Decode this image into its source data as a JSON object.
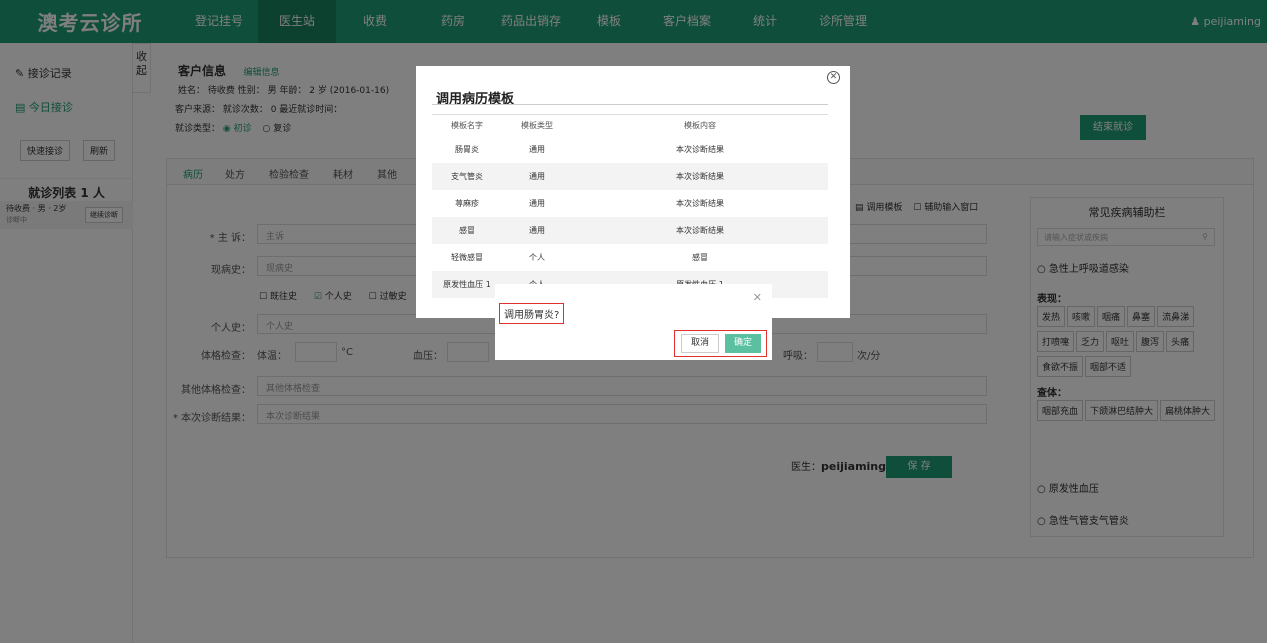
{
  "app": {
    "logo": "澳考云诊所",
    "user": "peijiaming"
  },
  "nav": [
    "登记挂号",
    "医生站",
    "收费",
    "药房",
    "药品出销存",
    "模板",
    "客户档案",
    "统计",
    "诊所管理"
  ],
  "sidebar": {
    "links": [
      "接诊记录",
      "今日接诊"
    ],
    "buttons": [
      "快速接诊",
      "刷新"
    ],
    "queue_title": "就诊列表 1 人",
    "patient": {
      "name": "待收费 · 男 · 2岁",
      "status": "诊断中",
      "action": "继续诊断"
    },
    "collapse": "收起"
  },
  "customer": {
    "header": "客户信息",
    "edit": "编辑信息",
    "line1": "姓名：  待收费     性别：  男     年龄：  2 岁 (2016-01-16)",
    "line2": "客户来源：     就诊次数：  0     最近就诊时间：",
    "line3_label": "就诊类型：",
    "visit_types": [
      "初诊",
      "复诊"
    ],
    "end_button": "结束就诊"
  },
  "tabs": [
    "病历",
    "处方",
    "检验检查",
    "耗材",
    "其他"
  ],
  "form": {
    "toolbar": [
      "调用模板",
      "辅助输入窗口"
    ],
    "chief_label": "* 主 诉：",
    "chief_value": "主诉",
    "present_label": "现病史：",
    "present_value": "现病史",
    "history_opts": [
      "既往史",
      "个人史",
      "过敏史"
    ],
    "personal_label": "个人史：",
    "personal_value": "个人史",
    "vitals_label": "体格检查：",
    "temp_label": "体温：",
    "temp_unit": "°C",
    "bp_label": "血压：",
    "resp_label": "呼吸：",
    "resp_unit": "次/分",
    "other_label": "其他体格检查：",
    "other_value": "其他体格检查",
    "diag_label": "* 本次诊断结果：",
    "diag_value": "本次诊断结果",
    "doctor_label": "医生：",
    "doctor": "peijiaming",
    "save": "保 存"
  },
  "assist": {
    "title": "常见疾病辅助栏",
    "search_placeholder": "请输入症状或疾病",
    "disease1": "急性上呼吸道感染",
    "symptom_label": "表现：",
    "symptoms": [
      "发热",
      "咳嗽",
      "咽痛",
      "鼻塞",
      "流鼻涕",
      "打喷嚏",
      "乏力",
      "呕吐",
      "腹泻",
      "头痛",
      "食欲不振",
      "咽部不适"
    ],
    "sign_label": "查体：",
    "signs": [
      "咽部充血",
      "下颌淋巴结肿大",
      "扁桃体肿大"
    ],
    "disease2": "原发性血压",
    "disease3": "急性气管支气管炎"
  },
  "modal": {
    "title": "调用病历模板",
    "headers": [
      "模板名字",
      "模板类型",
      "模板内容"
    ],
    "rows": [
      [
        "肠胃炎",
        "通用",
        "本次诊断结果"
      ],
      [
        "支气管炎",
        "通用",
        "本次诊断结果"
      ],
      [
        "荨麻疹",
        "通用",
        "本次诊断结果"
      ],
      [
        "感冒",
        "通用",
        "本次诊断结果"
      ],
      [
        "轻微感冒",
        "个人",
        "感冒"
      ],
      [
        "原发性血压 1",
        "个人",
        "原发性血压 1"
      ]
    ]
  },
  "confirm": {
    "message": "调用肠胃炎?",
    "cancel": "取消",
    "ok": "确定"
  }
}
